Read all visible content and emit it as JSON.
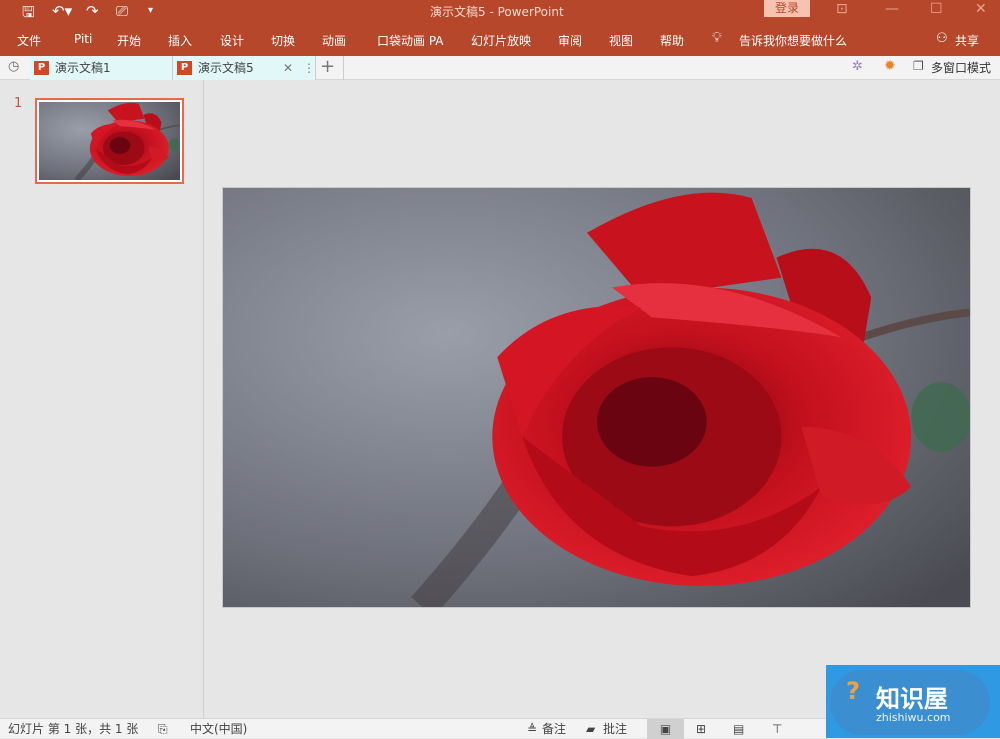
{
  "titlebar": {
    "title": "演示文稿5  -  PowerPoint",
    "login": "登录",
    "qa": [
      "save-icon",
      "undo-icon",
      "redo-icon",
      "slideshow-icon",
      "customize-icon"
    ]
  },
  "ribbon": {
    "tabs": [
      "文件",
      "Piti",
      "开始",
      "插入",
      "设计",
      "切换",
      "动画",
      "口袋动画 PA",
      "幻灯片放映",
      "审阅",
      "视图",
      "帮助"
    ],
    "tell_me": "告诉我你想要做什么",
    "share": "共享"
  },
  "doctabs": {
    "tabs": [
      "演示文稿1",
      "演示文稿5"
    ],
    "multiwindow": "多窗口模式"
  },
  "slides": {
    "number": "1"
  },
  "status": {
    "slide_info": "幻灯片 第 1 张，共 1 张",
    "language": "中文(中国)",
    "notes": "备注",
    "comments": "批注"
  },
  "watermark": {
    "name": "知识屋",
    "url": "zhishiwu.com"
  },
  "colors": {
    "accent": "#b7472a"
  }
}
